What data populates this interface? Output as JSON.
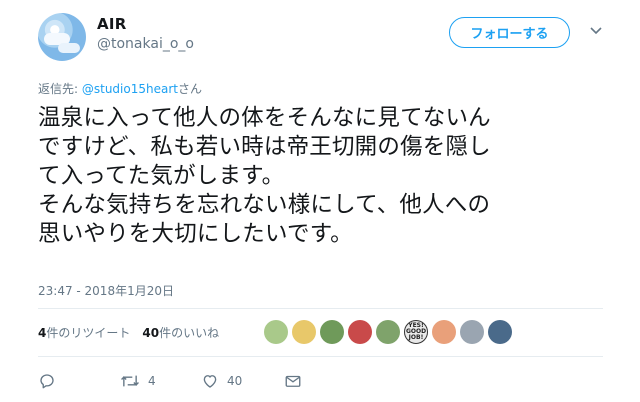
{
  "user": {
    "name": "AIR",
    "handle": "@tonakai_o_o"
  },
  "follow_button": "フォローする",
  "reply": {
    "prefix": "返信先: ",
    "mention": "@studio15heart",
    "suffix": "さん"
  },
  "tweet_lines": [
    "温泉に入って他人の体をそんなに見てないん",
    "ですけど、私も若い時は帝王切開の傷を隠し",
    "て入ってた気がします。",
    "そんな気持ちを忘れない様にして、他人への",
    "思いやりを大切にしたいです。"
  ],
  "timestamp": "23:47 - 2018年1月20日",
  "stats": {
    "retweet_count": "4",
    "retweet_label": "件のリツイート",
    "like_count": "40",
    "like_label": "件のいいね"
  },
  "likers": [
    {
      "icon": "liker-avatar-1",
      "color": "#a9c98a",
      "label": ""
    },
    {
      "icon": "liker-avatar-2",
      "color": "#e8c86a",
      "label": ""
    },
    {
      "icon": "liker-avatar-3",
      "color": "#6f9a5a",
      "label": ""
    },
    {
      "icon": "liker-avatar-4",
      "color": "#c94a4a",
      "label": ""
    },
    {
      "icon": "liker-avatar-5",
      "color": "#7fa36b",
      "label": ""
    },
    {
      "icon": "liker-avatar-6",
      "color": "#e9e9e9",
      "label": "YES! GOOD JOB!"
    },
    {
      "icon": "liker-avatar-7",
      "color": "#e9a07a",
      "label": ""
    },
    {
      "icon": "liker-avatar-8",
      "color": "#9aa5b1",
      "label": ""
    },
    {
      "icon": "liker-avatar-9",
      "color": "#4a6a8a",
      "label": ""
    }
  ],
  "actions": {
    "retweets": "4",
    "likes": "40"
  },
  "colors": {
    "accent": "#1da1f2",
    "muted": "#657786",
    "text": "#14171a"
  }
}
